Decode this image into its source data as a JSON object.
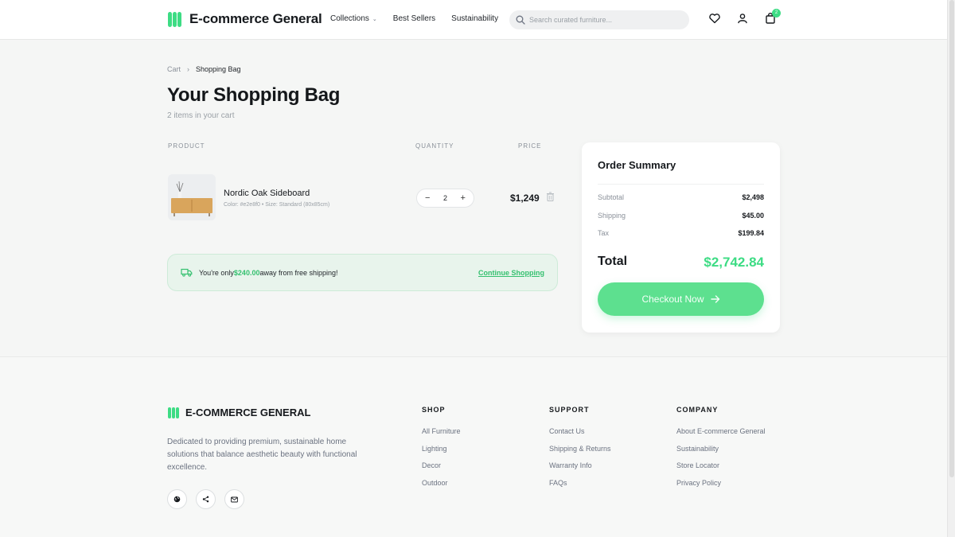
{
  "header": {
    "brand": "E-commerce General",
    "nav": [
      {
        "label": "Collections",
        "has_dropdown": true
      },
      {
        "label": "Best Sellers"
      },
      {
        "label": "Sustainability"
      }
    ],
    "search_placeholder": "Search curated furniture...",
    "cart_count": "2"
  },
  "breadcrumb": {
    "root": "Cart",
    "sep": "›",
    "current": "Shopping Bag"
  },
  "page": {
    "title": "Your Shopping Bag",
    "subtitle": "2 items in your cart",
    "col_product": "PRODUCT",
    "col_quantity": "QUANTITY",
    "col_price": "PRICE"
  },
  "cart_item": {
    "name": "Nordic Oak Sideboard",
    "meta": "Color: #e2e8f0 • Size: Standard (80x85cm)",
    "quantity": "2",
    "price": "$1,249",
    "minus": "−",
    "plus": "+"
  },
  "shipping_banner": {
    "text_before": "You're only ",
    "amount": "$240.00",
    "text_after": " away from free shipping!",
    "link": "Continue Shopping"
  },
  "summary": {
    "title": "Order Summary",
    "subtotal_label": "Subtotal",
    "subtotal": "$2,498",
    "shipping_label": "Shipping",
    "shipping": "$45.00",
    "tax_label": "Tax",
    "tax": "$199.84",
    "total_label": "Total",
    "total": "$2,742.84",
    "checkout": "Checkout Now"
  },
  "footer": {
    "brand": "E-COMMERCE GENERAL",
    "description": "Dedicated to providing premium, sustainable home solutions that balance aesthetic beauty with functional excellence.",
    "shop": {
      "title": "SHOP",
      "links": [
        "All Furniture",
        "Lighting",
        "Decor",
        "Outdoor"
      ]
    },
    "support": {
      "title": "SUPPORT",
      "links": [
        "Contact Us",
        "Shipping & Returns",
        "Warranty Info",
        "FAQs"
      ]
    },
    "company": {
      "title": "COMPANY",
      "links": [
        "About E-commerce General",
        "Sustainability",
        "Store Locator",
        "Privacy Policy"
      ]
    }
  },
  "colors": {
    "accent": "#3ddc84",
    "background": "#f5f6f5",
    "text": "#16191d"
  },
  "icons": [
    "logo-icon",
    "chevron-down-icon",
    "search-icon",
    "heart-icon",
    "user-icon",
    "shopping-bag-icon",
    "trash-icon",
    "truck-icon",
    "arrow-right-icon",
    "globe-icon",
    "share-icon",
    "mail-icon"
  ]
}
